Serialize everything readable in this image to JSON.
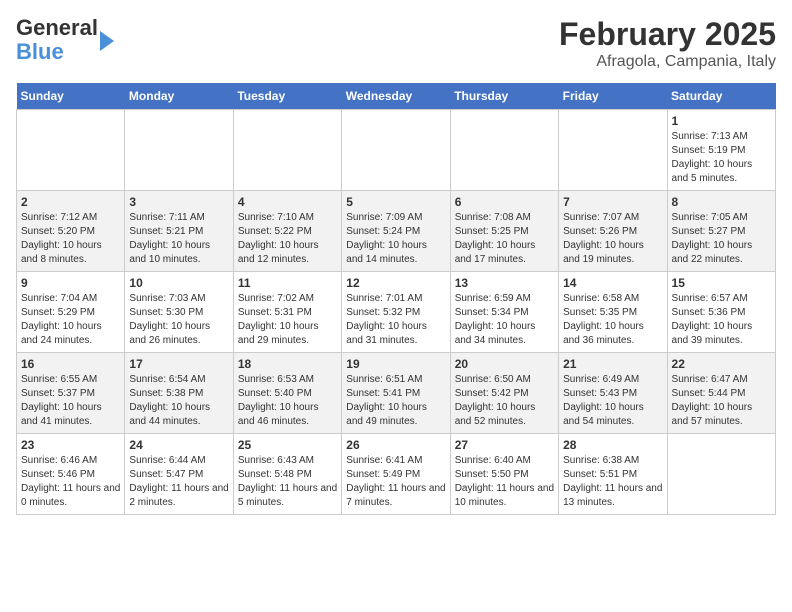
{
  "header": {
    "logo_line1": "General",
    "logo_line2": "Blue",
    "title": "February 2025",
    "subtitle": "Afragola, Campania, Italy"
  },
  "calendar": {
    "days_of_week": [
      "Sunday",
      "Monday",
      "Tuesday",
      "Wednesday",
      "Thursday",
      "Friday",
      "Saturday"
    ],
    "weeks": [
      [
        {
          "day": "",
          "info": ""
        },
        {
          "day": "",
          "info": ""
        },
        {
          "day": "",
          "info": ""
        },
        {
          "day": "",
          "info": ""
        },
        {
          "day": "",
          "info": ""
        },
        {
          "day": "",
          "info": ""
        },
        {
          "day": "1",
          "info": "Sunrise: 7:13 AM\nSunset: 5:19 PM\nDaylight: 10 hours and 5 minutes."
        }
      ],
      [
        {
          "day": "2",
          "info": "Sunrise: 7:12 AM\nSunset: 5:20 PM\nDaylight: 10 hours and 8 minutes."
        },
        {
          "day": "3",
          "info": "Sunrise: 7:11 AM\nSunset: 5:21 PM\nDaylight: 10 hours and 10 minutes."
        },
        {
          "day": "4",
          "info": "Sunrise: 7:10 AM\nSunset: 5:22 PM\nDaylight: 10 hours and 12 minutes."
        },
        {
          "day": "5",
          "info": "Sunrise: 7:09 AM\nSunset: 5:24 PM\nDaylight: 10 hours and 14 minutes."
        },
        {
          "day": "6",
          "info": "Sunrise: 7:08 AM\nSunset: 5:25 PM\nDaylight: 10 hours and 17 minutes."
        },
        {
          "day": "7",
          "info": "Sunrise: 7:07 AM\nSunset: 5:26 PM\nDaylight: 10 hours and 19 minutes."
        },
        {
          "day": "8",
          "info": "Sunrise: 7:05 AM\nSunset: 5:27 PM\nDaylight: 10 hours and 22 minutes."
        }
      ],
      [
        {
          "day": "9",
          "info": "Sunrise: 7:04 AM\nSunset: 5:29 PM\nDaylight: 10 hours and 24 minutes."
        },
        {
          "day": "10",
          "info": "Sunrise: 7:03 AM\nSunset: 5:30 PM\nDaylight: 10 hours and 26 minutes."
        },
        {
          "day": "11",
          "info": "Sunrise: 7:02 AM\nSunset: 5:31 PM\nDaylight: 10 hours and 29 minutes."
        },
        {
          "day": "12",
          "info": "Sunrise: 7:01 AM\nSunset: 5:32 PM\nDaylight: 10 hours and 31 minutes."
        },
        {
          "day": "13",
          "info": "Sunrise: 6:59 AM\nSunset: 5:34 PM\nDaylight: 10 hours and 34 minutes."
        },
        {
          "day": "14",
          "info": "Sunrise: 6:58 AM\nSunset: 5:35 PM\nDaylight: 10 hours and 36 minutes."
        },
        {
          "day": "15",
          "info": "Sunrise: 6:57 AM\nSunset: 5:36 PM\nDaylight: 10 hours and 39 minutes."
        }
      ],
      [
        {
          "day": "16",
          "info": "Sunrise: 6:55 AM\nSunset: 5:37 PM\nDaylight: 10 hours and 41 minutes."
        },
        {
          "day": "17",
          "info": "Sunrise: 6:54 AM\nSunset: 5:38 PM\nDaylight: 10 hours and 44 minutes."
        },
        {
          "day": "18",
          "info": "Sunrise: 6:53 AM\nSunset: 5:40 PM\nDaylight: 10 hours and 46 minutes."
        },
        {
          "day": "19",
          "info": "Sunrise: 6:51 AM\nSunset: 5:41 PM\nDaylight: 10 hours and 49 minutes."
        },
        {
          "day": "20",
          "info": "Sunrise: 6:50 AM\nSunset: 5:42 PM\nDaylight: 10 hours and 52 minutes."
        },
        {
          "day": "21",
          "info": "Sunrise: 6:49 AM\nSunset: 5:43 PM\nDaylight: 10 hours and 54 minutes."
        },
        {
          "day": "22",
          "info": "Sunrise: 6:47 AM\nSunset: 5:44 PM\nDaylight: 10 hours and 57 minutes."
        }
      ],
      [
        {
          "day": "23",
          "info": "Sunrise: 6:46 AM\nSunset: 5:46 PM\nDaylight: 11 hours and 0 minutes."
        },
        {
          "day": "24",
          "info": "Sunrise: 6:44 AM\nSunset: 5:47 PM\nDaylight: 11 hours and 2 minutes."
        },
        {
          "day": "25",
          "info": "Sunrise: 6:43 AM\nSunset: 5:48 PM\nDaylight: 11 hours and 5 minutes."
        },
        {
          "day": "26",
          "info": "Sunrise: 6:41 AM\nSunset: 5:49 PM\nDaylight: 11 hours and 7 minutes."
        },
        {
          "day": "27",
          "info": "Sunrise: 6:40 AM\nSunset: 5:50 PM\nDaylight: 11 hours and 10 minutes."
        },
        {
          "day": "28",
          "info": "Sunrise: 6:38 AM\nSunset: 5:51 PM\nDaylight: 11 hours and 13 minutes."
        },
        {
          "day": "",
          "info": ""
        }
      ]
    ]
  }
}
